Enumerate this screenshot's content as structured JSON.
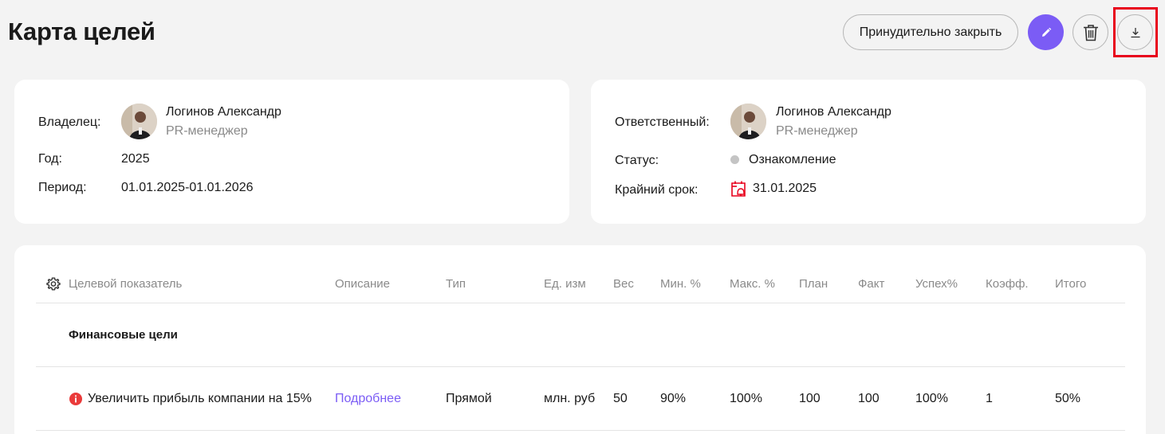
{
  "header": {
    "title": "Карта целей",
    "force_close_label": "Принудительно закрыть"
  },
  "toolbar": {
    "edit_icon": "pencil-icon",
    "delete_icon": "trash-icon",
    "download_icon": "download-icon",
    "accent_color": "#7b5cf5",
    "highlight_color": "#e8001c"
  },
  "owner_card": {
    "owner_label": "Владелец:",
    "owner_name": "Логинов Александр",
    "owner_role": "PR-менеджер",
    "year_label": "Год:",
    "year_value": "2025",
    "period_label": "Период:",
    "period_value": "01.01.2025-01.01.2026"
  },
  "responsible_card": {
    "responsible_label": "Ответственный:",
    "responsible_name": "Логинов Александр",
    "responsible_role": "PR-менеджер",
    "status_label": "Статус:",
    "status_value": "Ознакомление",
    "deadline_label": "Крайний срок:",
    "deadline_value": "31.01.2025",
    "deadline_icon": "calendar-alarm-icon",
    "deadline_icon_color": "#e8001c"
  },
  "table": {
    "settings_icon": "gear-icon",
    "columns": [
      "Целевой показатель",
      "Описание",
      "Тип",
      "Ед. изм",
      "Вес",
      "Мин. %",
      "Макс. %",
      "План",
      "Факт",
      "Успех%",
      "Коэфф.",
      "Итого"
    ],
    "group_title": "Финансовые цели",
    "rows": [
      {
        "indicator": "Увеличить прибыль компании на 15%",
        "description": "Подробнее",
        "type": "Прямой",
        "unit": "млн. руб",
        "weight": "50",
        "min": "90%",
        "max": "100%",
        "plan": "100",
        "fact": "100",
        "success": "100%",
        "coeff": "1",
        "total": "50%"
      }
    ]
  }
}
